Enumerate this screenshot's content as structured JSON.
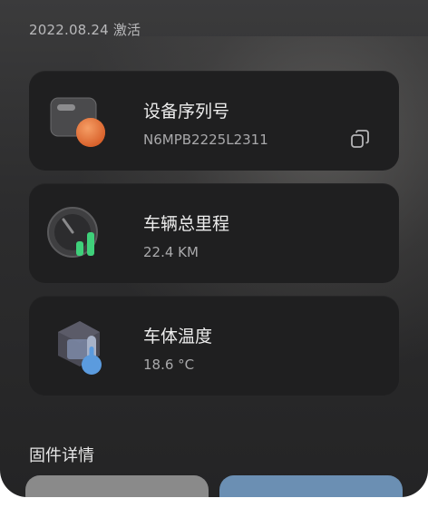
{
  "activation_text": "2022.08.24 激活",
  "cards": [
    {
      "label": "设备序列号",
      "value": "N6MPB2225L2311",
      "icon": "device-serial-icon",
      "copy_icon": "copy-icon"
    },
    {
      "label": "车辆总里程",
      "value": "22.4 KM",
      "icon": "odometer-icon"
    },
    {
      "label": "车体温度",
      "value": "18.6 °C",
      "icon": "thermometer-icon"
    }
  ],
  "section": {
    "title": "固件详情"
  },
  "colors": {
    "card_bg": "#1f1f20",
    "accent_orange": "#e8703a",
    "accent_green": "#3fd07a",
    "accent_blue": "#5b9bde",
    "tile_grey": "#8a8a8a",
    "tile_blue": "#6b8fb3"
  }
}
